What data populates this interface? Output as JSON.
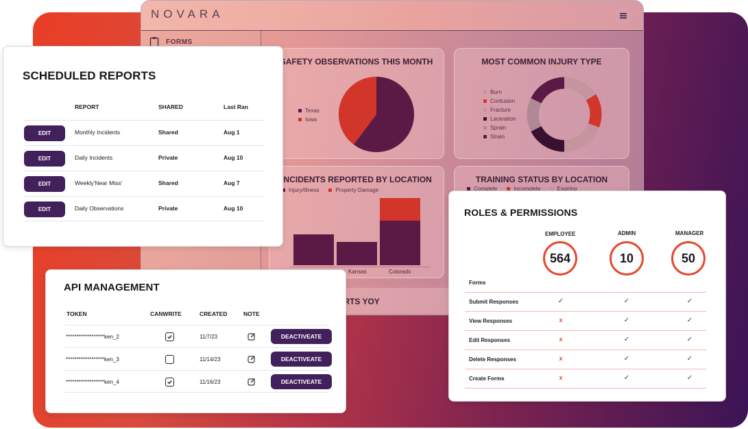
{
  "app": {
    "logo": "NOVARA",
    "side_item": "FORMS"
  },
  "panels": {
    "safety": {
      "title": "SAFETY OBSERVATIONS THIS MONTH",
      "legend": [
        "Texas",
        "Iowa"
      ]
    },
    "injury": {
      "title": "MOST COMMON INJURY TYPE",
      "legend": [
        "Burn",
        "Contusion",
        "Fracture",
        "Laceration",
        "Sprain",
        "Strain"
      ]
    },
    "incidents": {
      "title": "INCIDENTS REPORTED BY LOCATION",
      "legend": [
        "Injury/Illness",
        "Property Damage"
      ],
      "x_labels": [
        "Kansas",
        "Colorado"
      ]
    },
    "training": {
      "title": "TRAINING STATUS BY LOCATION",
      "legend": [
        "Complete",
        "Incomplete",
        "Expiring"
      ]
    },
    "lower": {
      "title": "ORTS YOY"
    }
  },
  "colors": {
    "accent": "#41205c",
    "red": "#e8462c",
    "dark": "#5b1a45",
    "brand_red": "#d2352a"
  },
  "scheduled_reports": {
    "title": "SCHEDULED REPORTS",
    "headers": {
      "report": "REPORT",
      "shared": "SHARED",
      "last_ran": "Last Ran"
    },
    "edit_label": "EDIT",
    "rows": [
      {
        "report": "Monthly Incidents",
        "shared": "Shared",
        "last_ran": "Aug 1"
      },
      {
        "report": "Daily Incidents",
        "shared": "Private",
        "last_ran": "Aug 10"
      },
      {
        "report": "Weekly'Near Miss'",
        "shared": "Shared",
        "last_ran": "Aug 7"
      },
      {
        "report": "Daily Observations",
        "shared": "Private",
        "last_ran": "Aug 10"
      }
    ]
  },
  "api_management": {
    "title": "API MANAGEMENT",
    "headers": {
      "token": "TOKEN",
      "canwrite": "CANWRITE",
      "created": "CREATED",
      "note": "NOTE"
    },
    "deactivate_label": "DEACTIVEATE",
    "rows": [
      {
        "token": "******************ken_2",
        "canwrite": true,
        "created": "11/7/23"
      },
      {
        "token": "******************ken_3",
        "canwrite": false,
        "created": "11/14/23"
      },
      {
        "token": "******************ken_4",
        "canwrite": true,
        "created": "11/16/23"
      }
    ]
  },
  "roles": {
    "title": "ROLES & PERMISSIONS",
    "columns": [
      {
        "label": "EMPLOYEE",
        "count": "564"
      },
      {
        "label": "ADMIN",
        "count": "10"
      },
      {
        "label": "MANAGER",
        "count": "50"
      }
    ],
    "section": "Forms",
    "rows": [
      {
        "label": "Submit Responses",
        "marks": [
          "check",
          "check",
          "check"
        ]
      },
      {
        "label": "View Responses",
        "marks": [
          "x",
          "check",
          "check"
        ]
      },
      {
        "label": "Edit Responses",
        "marks": [
          "x",
          "check",
          "check"
        ]
      },
      {
        "label": "Delete Responses",
        "marks": [
          "x",
          "check",
          "check"
        ]
      },
      {
        "label": "Create Forms",
        "marks": [
          "x",
          "check",
          "check"
        ]
      }
    ],
    "check_glyph": "✓",
    "x_glyph": "x"
  }
}
